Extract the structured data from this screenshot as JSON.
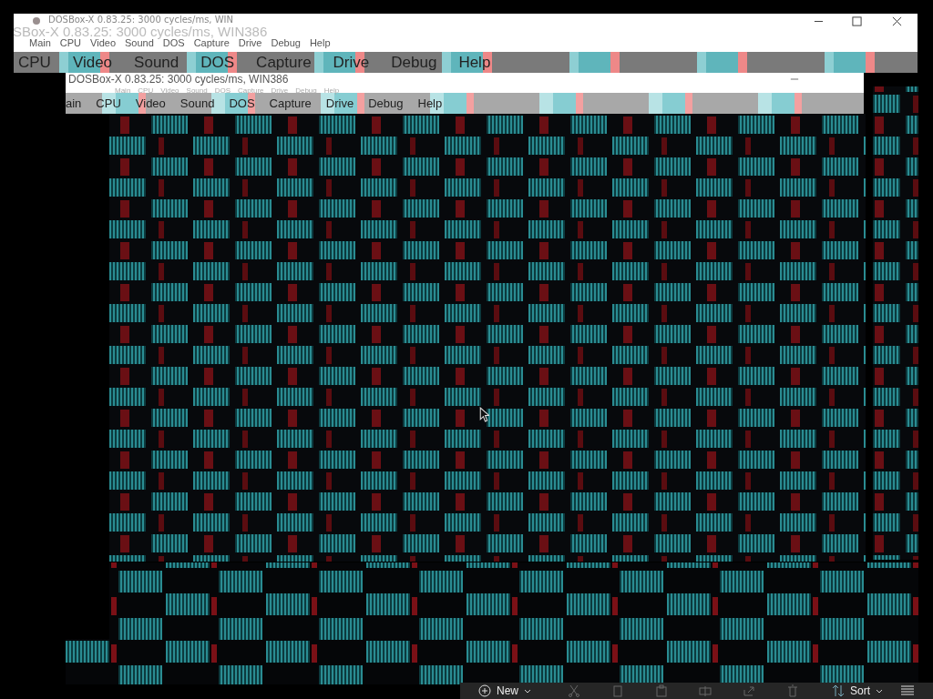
{
  "outer_window": {
    "title": "DOSBox-X 0.83.25: 3000 cycles/ms, WIN",
    "title_ghost": "SBox-X 0.83.25: 3000 cycles/ms, WIN386",
    "menu": [
      "Main",
      "CPU",
      "Video",
      "Sound",
      "DOS",
      "Capture",
      "Drive",
      "Debug",
      "Help"
    ],
    "glitched_menu": [
      "CPU",
      "Video",
      "Sound",
      "DOS",
      "Capture",
      "Drive",
      "Debug",
      "Help"
    ]
  },
  "inner_window": {
    "title": "DOSBox-X 0.83.25: 3000 cycles/ms, WIN386",
    "menu": [
      "Main",
      "CPU",
      "Video",
      "Sound",
      "DOS",
      "Capture",
      "Drive",
      "Debug",
      "Help"
    ],
    "glitched_menu": [
      "ain",
      "CPU",
      "Video",
      "Sound",
      "DOS",
      "Capture",
      "Drive",
      "Debug",
      "Help"
    ]
  },
  "toolbar": {
    "new_label": "New",
    "sort_label": "Sort"
  }
}
